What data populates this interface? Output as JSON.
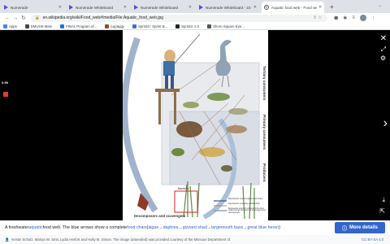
{
  "browser": {
    "tabs": [
      {
        "label": "Numerade",
        "icon": "numerade-icon"
      },
      {
        "label": "Numerade Whiteboard",
        "icon": "numerade-icon"
      },
      {
        "label": "Numerade Whiteboard",
        "icon": "numerade-icon"
      },
      {
        "label": "Numerade Whiteboard - 15 hi...",
        "icon": "numerade-icon"
      },
      {
        "label": "Aquatic food web - Food web...",
        "icon": "wikipedia-icon",
        "active": true
      }
    ],
    "url": "en.wikipedia.org/wiki/Food_web#/media/File:Aquatic_food_web.jpg",
    "bookmarks": [
      {
        "label": "Apps",
        "color": "#4285f4"
      },
      {
        "label": "DMUHS Main",
        "color": "#444444"
      },
      {
        "label": "FINAL Program of...",
        "color": "#1a73e8"
      },
      {
        "label": "(ug)aggy",
        "color": "#8a4b2b"
      },
      {
        "label": "Sprintzr: Sprint B...",
        "color": "#3b6fd6"
      },
      {
        "label": "Sprintzr 2.0",
        "color": "#222222"
      },
      {
        "label": "Shore Square Eye...",
        "color": "#555555"
      }
    ]
  },
  "viewer": {
    "timer": "0:59",
    "illustration": {
      "labels": {
        "top_right": "Tertiary consumers",
        "mid_right": "Primary consumers",
        "low_right": "Producers",
        "bottom": "Decomposers and scavengers",
        "water_label": "Bacteria"
      },
      "legend": [
        "Represents one complete food chain",
        "Represents a feeding relationship",
        "Represents return of nutrients to the food chain through the action of scavengers and decomposers"
      ]
    }
  },
  "caption": {
    "prefix": "A freshwater ",
    "link1": "aquatic",
    "mid1": " food web. The blue arrows show a complete ",
    "link2": "food chain",
    "mid2": " (",
    "link3": "algae",
    "arrow": " → ",
    "link4": "daphnia",
    "link5": "gizzard shad",
    "link6": "largemouth bass",
    "link7": "great blue heron",
    "suffix": ")",
    "more_details": "More details"
  },
  "credit": {
    "text": "Kestin Schulz, Mariya W. Smit, Lydia Herfort and Holly M. Simon. The image (amended) was provided courtesy of the Missouri Department of",
    "license": "CC BY-SA 4.0"
  }
}
